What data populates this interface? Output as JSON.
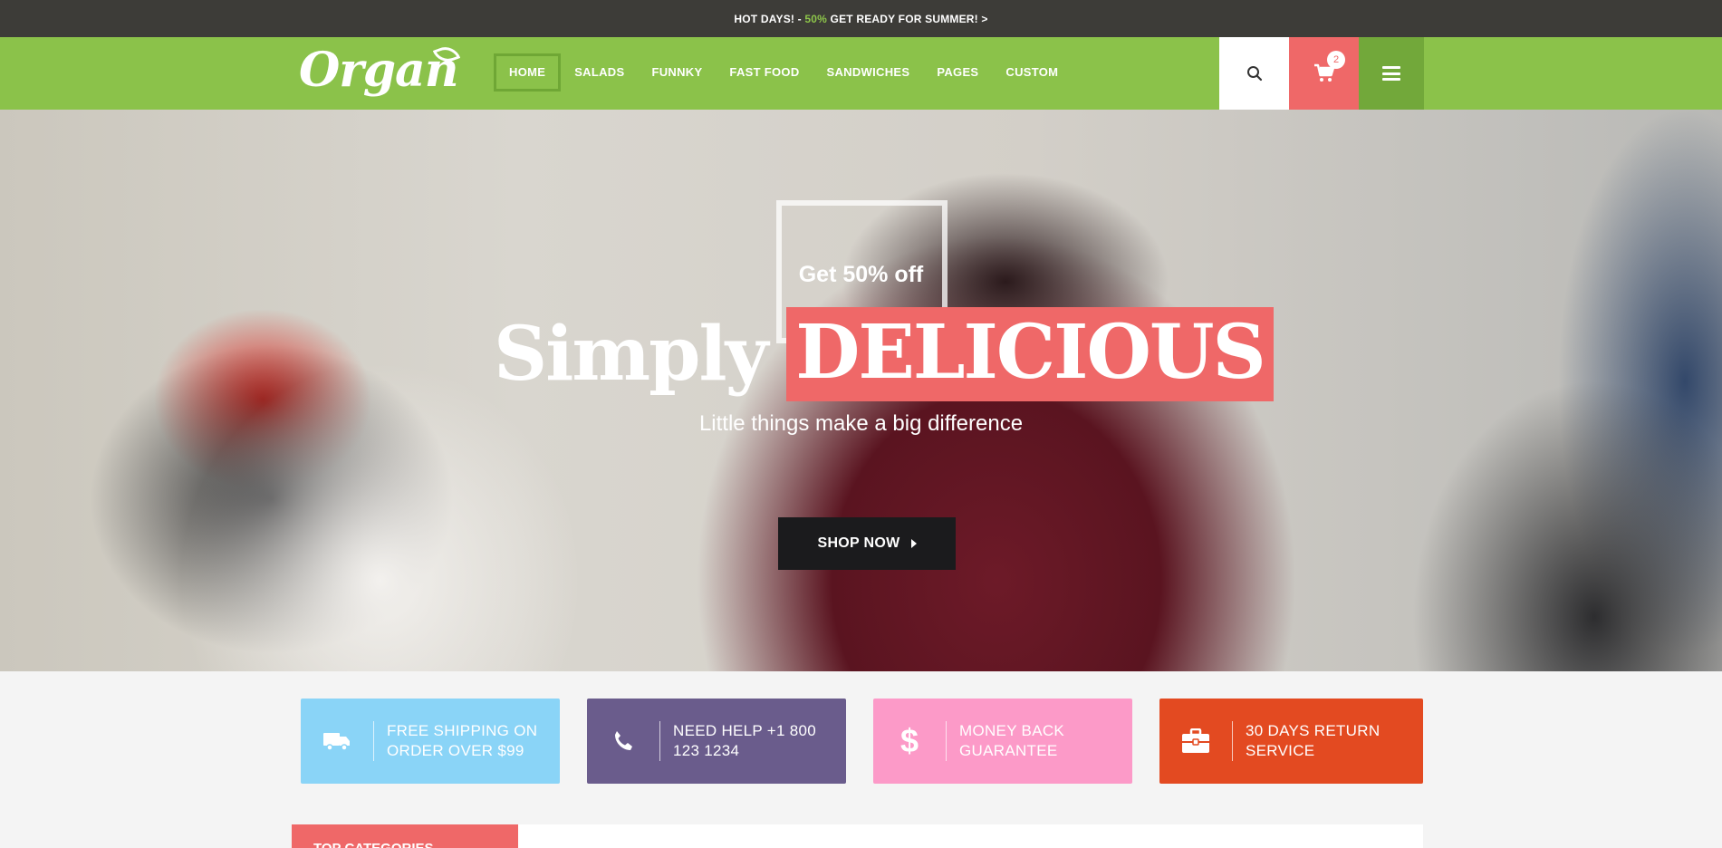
{
  "topbar": {
    "prefix": "HOT DAYS! -",
    "percent": "50%",
    "suffix": "GET READY FOR SUMMER! >"
  },
  "header": {
    "logo": "Organ",
    "nav": [
      {
        "label": "HOME",
        "active": true
      },
      {
        "label": "SALADS"
      },
      {
        "label": "FUNNKY"
      },
      {
        "label": "FAST FOOD"
      },
      {
        "label": "SANDWICHES"
      },
      {
        "label": "PAGES"
      },
      {
        "label": "CUSTOM"
      }
    ],
    "search_icon": "search-icon",
    "cart_icon": "cart-icon",
    "cart_count": "2",
    "menu_icon": "hamburger-icon"
  },
  "hero": {
    "pretitle": "Get 50% off",
    "title_plain": "Simply",
    "title_highlight": "DELICIOUS",
    "subtitle": "Little things make a big difference",
    "cta": "SHOP NOW"
  },
  "features": [
    {
      "icon": "truck-icon",
      "line1": "FREE SHIPPING ON",
      "line2": "ORDER OVER $99"
    },
    {
      "icon": "phone-icon",
      "line1": "NEED HELP +1 800",
      "line2": "123 1234"
    },
    {
      "icon": "dollar-icon",
      "line1": "MONEY BACK",
      "line2": "GUARANTEE"
    },
    {
      "icon": "briefcase-icon",
      "line1": "30 DAYS RETURN",
      "line2": "SERVICE"
    }
  ],
  "section": {
    "tab_label": "TOP CATEGORIES"
  },
  "colors": {
    "brand_green": "#8bc24a",
    "accent_red": "#ef6868",
    "topbar_bg": "#3d3c38",
    "feature_blue": "#8ad4f7",
    "feature_purple": "#6a5c8c",
    "feature_pink": "#fc9ac8",
    "feature_orange": "#e34a21"
  }
}
